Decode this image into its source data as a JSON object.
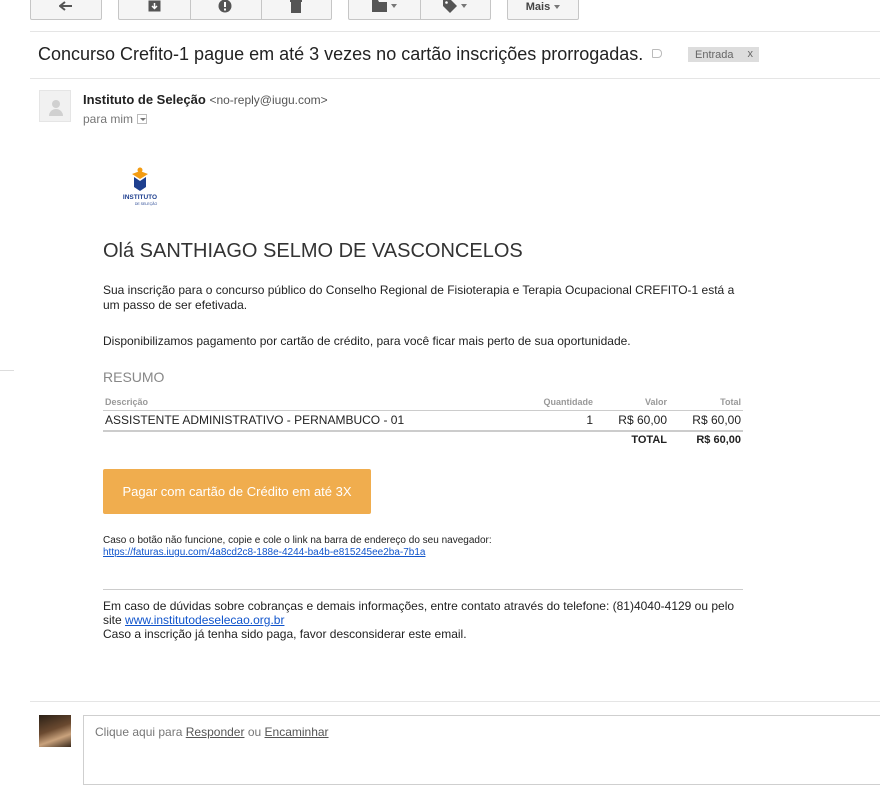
{
  "toolbar": {
    "more_label": "Mais"
  },
  "subject": "Concurso Crefito-1 pague em até 3 vezes no cartão inscrições prorrogadas.",
  "label_tag": {
    "name": "Entrada",
    "remove": "x"
  },
  "sender": {
    "name": "Instituto de Seleção",
    "email": "<no-reply@iugu.com>",
    "recipient": "para mim"
  },
  "logo": {
    "line1": "INSTITUTO",
    "line2": "DE SELEÇÃO"
  },
  "body": {
    "greeting": "Olá SANTHIAGO SELMO DE VASCONCELOS",
    "intro": "Sua inscrição para o concurso público do Conselho Regional de Fisioterapia e Terapia Ocupacional CREFITO-1 está a um passo de ser efetivada.",
    "payment_note": "Disponibilizamos pagamento por cartão de crédito, para você ficar mais perto de sua oportunidade.",
    "summary_title": "RESUMO",
    "table": {
      "headers": {
        "desc": "Descrição",
        "qty": "Quantidade",
        "value": "Valor",
        "total": "Total"
      },
      "rows": [
        {
          "desc": "ASSISTENTE ADMINISTRATIVO - PERNAMBUCO - 01",
          "qty": "1",
          "value": "R$ 60,00",
          "total": "R$ 60,00"
        }
      ],
      "total_label": "TOTAL",
      "total_value": "R$ 60,00"
    },
    "pay_button": "Pagar com cartão de Crédito em até 3X",
    "fallback_text": "Caso o botão não funcione, copie e cole o link na barra de endereço do seu navegador:",
    "fallback_link": "https://faturas.iugu.com/4a8cd2c8-188e-4244-ba4b-e815245ee2ba-7b1a",
    "footer_line1": "Em caso de dúvidas sobre cobranças e demais informações, entre contato através do telefone: (81)4040-4129 ou pelo site",
    "footer_site": "www.institutodeselecao.org.br",
    "footer_line2": "Caso a inscrição já tenha sido paga, favor desconsiderar este email."
  },
  "reply": {
    "prefix": "Clique aqui para",
    "reply_link": "Responder",
    "or": "ou",
    "forward_link": "Encaminhar"
  },
  "colors": {
    "pay_button": "#f0ad4e",
    "link": "#1155cc",
    "logo_blue": "#1e3f8f",
    "logo_orange": "#f39c12"
  }
}
